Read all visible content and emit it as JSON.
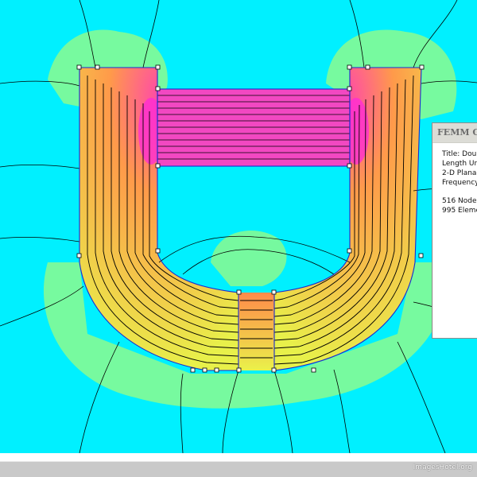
{
  "colors": {
    "background_field": "#00f0ff",
    "low_field_halo": "#7dfa9a",
    "core_yellow": "#e8f04a",
    "core_orange": "#ff9a4a",
    "hot_magenta": "#ff2ad8",
    "conductor_block": "#f248c2",
    "outline_blue": "#1a2bd0",
    "contour_black": "#000000"
  },
  "output_window": {
    "title": "FEMM Ou",
    "lines": [
      "Title: Dou",
      "Length Ur",
      "2-D Plana",
      "Frequency"
    ],
    "stats": [
      "516 Node",
      "995 Eleme"
    ]
  },
  "watermark": "ImagesHotel.org"
}
